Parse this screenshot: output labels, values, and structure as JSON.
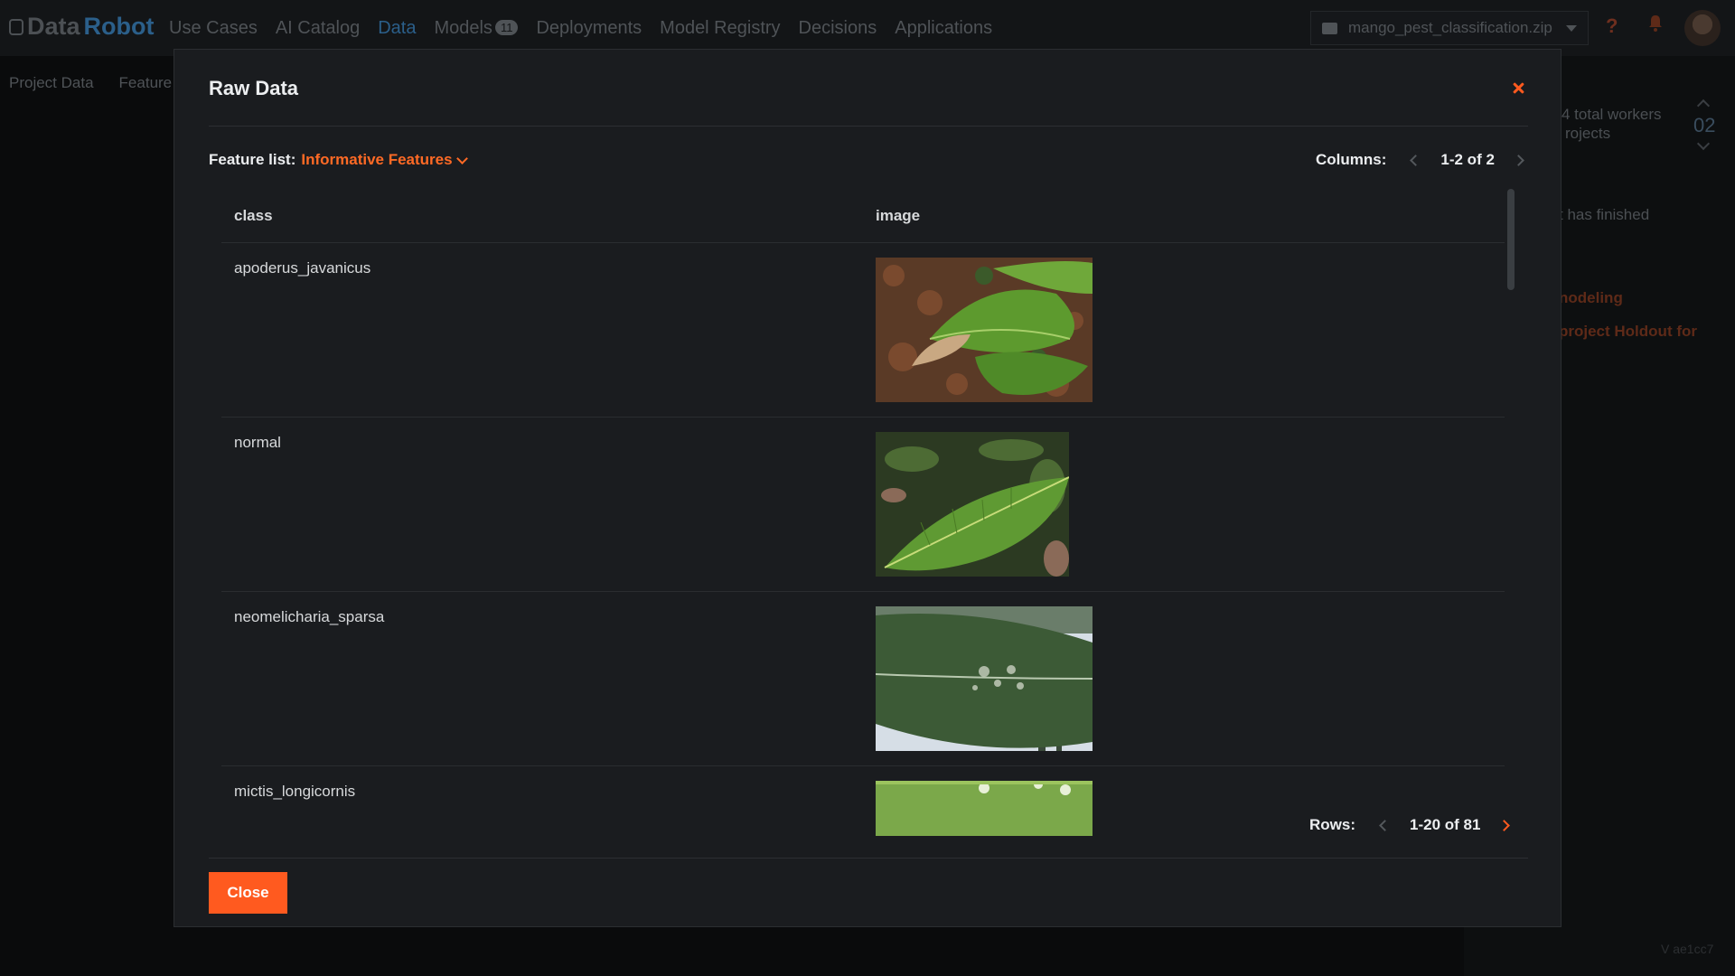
{
  "app": {
    "logo_data": "Data",
    "logo_robot": "Robot",
    "nav": [
      {
        "label": "Use Cases"
      },
      {
        "label": "AI Catalog"
      },
      {
        "label": "Data",
        "active": true
      },
      {
        "label": "Models",
        "badge": "11"
      },
      {
        "label": "Deployments"
      },
      {
        "label": "Model Registry"
      },
      {
        "label": "Decisions"
      },
      {
        "label": "Applications"
      }
    ],
    "project_name": "mango_pest_classification.zip",
    "help_glyph": "?",
    "subnav": [
      "Project Data",
      "Feature I"
    ],
    "right_panel": {
      "workers_line1": "4 total workers",
      "workers_line2": "rojects",
      "worker_count": "02",
      "status": "t has finished",
      "link1": "nodeling",
      "link2": "project Holdout for"
    },
    "version": "V ae1cc7"
  },
  "modal": {
    "title": "Raw Data",
    "feature_list_label": "Feature list:",
    "feature_list_value": "Informative Features",
    "columns_label": "Columns:",
    "columns_range": "1-2 of 2",
    "table": {
      "headers": [
        "class",
        "image"
      ],
      "rows": [
        {
          "class": "apoderus_javanicus",
          "image_desc": "leaf-on-soil"
        },
        {
          "class": "normal",
          "image_desc": "healthy-leaf"
        },
        {
          "class": "neomelicharia_sparsa",
          "image_desc": "leaf-with-white-spots"
        },
        {
          "class": "mictis_longicornis",
          "image_desc": "leaf-partial"
        }
      ]
    },
    "rows_label": "Rows:",
    "rows_range": "1-20 of 81",
    "close_label": "Close"
  },
  "colors": {
    "accent": "#ff5a1f",
    "modal_bg": "#1a1c1f",
    "page_bg": "#0a0b0c"
  }
}
